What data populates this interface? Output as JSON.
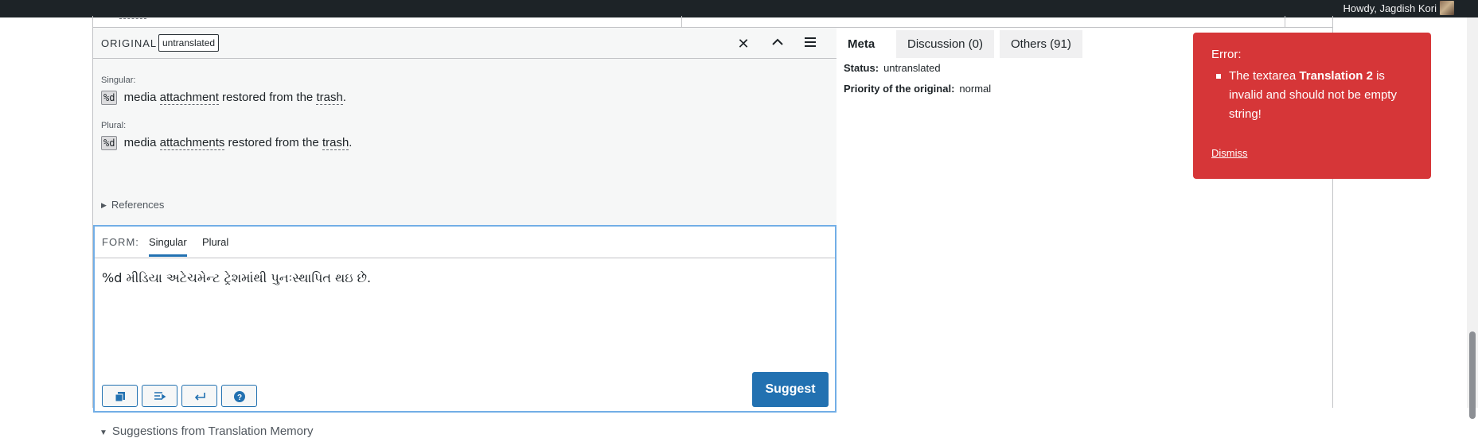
{
  "adminbar": {
    "greeting": "Howdy, Jagdish Kori"
  },
  "original": {
    "header_label": "ORIGINAL",
    "status": "untranslated",
    "singular_label": "Singular:",
    "singular": {
      "placeholder": "%d",
      "pre": "media",
      "term1": "attachment",
      "mid": "restored from the",
      "term2": "trash",
      "end": "."
    },
    "plural_label": "Plural:",
    "plural": {
      "placeholder": "%d",
      "pre": "media",
      "term1": "attachments",
      "mid": "restored from the",
      "term2": "trash",
      "end": "."
    },
    "references": "References"
  },
  "form": {
    "label": "FORM:",
    "tabs": [
      "Singular",
      "Plural"
    ],
    "active_tab": "Singular",
    "translation": "%d મીડિયા અટેચમેન્ટ ટ્રેશમાંથી પુનઃસ્થાપિત થઇ છે.",
    "tools": [
      "copy-icon",
      "insert-icon",
      "newline-icon",
      "help-icon"
    ],
    "suggest_label": "Suggest"
  },
  "tm": {
    "label": "Suggestions from Translation Memory"
  },
  "meta": {
    "tabs": [
      "Meta",
      "Discussion (0)",
      "Others (91)"
    ],
    "active_tab": "Meta",
    "status_label": "Status:",
    "status_value": "untranslated",
    "priority_label": "Priority of the original:",
    "priority_value": "normal"
  },
  "error": {
    "title": "Error:",
    "message_pre": "The textarea",
    "message_bold": "Translation 2",
    "message_post": "is invalid and should not be empty string!",
    "dismiss": "Dismiss",
    "color": "#d63638"
  },
  "colors": {
    "accent": "#2271b1",
    "focus": "#72aee6",
    "adminbar": "#1d2327"
  }
}
